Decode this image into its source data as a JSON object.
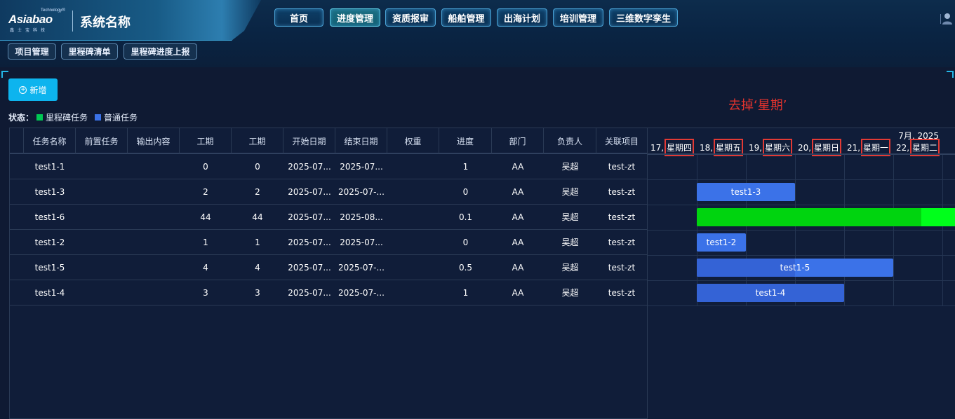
{
  "header": {
    "logo_trademark": "Technology®",
    "logo_text": "Asiabao",
    "logo_tagline": "鑫士宝科技",
    "app_title": "系统名称",
    "nav": [
      {
        "label": "首页",
        "active": false
      },
      {
        "label": "进度管理",
        "active": true
      },
      {
        "label": "资质报审",
        "active": false
      },
      {
        "label": "船舶管理",
        "active": false
      },
      {
        "label": "出海计划",
        "active": false
      },
      {
        "label": "培训管理",
        "active": false
      },
      {
        "label": "三维数字孪生",
        "active": false
      }
    ],
    "sub_nav": [
      "项目管理",
      "里程碑清单",
      "里程碑进度上报"
    ]
  },
  "toolbar": {
    "add_label": "新增",
    "add_icon": "plus-circle-icon"
  },
  "legend": {
    "label": "状态：",
    "items": [
      {
        "name": "里程碑任务",
        "color": "#00c853"
      },
      {
        "name": "普通任务",
        "color": "#3b72e8"
      }
    ]
  },
  "annotation": "去掉‘星期’",
  "table": {
    "columns": [
      "任务名称",
      "前置任务",
      "输出内容",
      "工期",
      "工期",
      "开始日期",
      "结束日期",
      "权重",
      "进度",
      "部门",
      "负责人",
      "关联项目"
    ],
    "rows": [
      {
        "name": "test1-1",
        "pre": "",
        "output": "",
        "dur1": "0",
        "dur2": "0",
        "start": "2025-07...",
        "end": "2025-07...",
        "weight": "",
        "progress": "1",
        "dept": "AA",
        "owner": "吴超",
        "project": "test-zt"
      },
      {
        "name": "test1-3",
        "pre": "",
        "output": "",
        "dur1": "2",
        "dur2": "2",
        "start": "2025-07...",
        "end": "2025-07-...",
        "weight": "",
        "progress": "0",
        "dept": "AA",
        "owner": "吴超",
        "project": "test-zt"
      },
      {
        "name": "test1-6",
        "pre": "",
        "output": "",
        "dur1": "44",
        "dur2": "44",
        "start": "2025-07...",
        "end": "2025-08...",
        "weight": "",
        "progress": "0.1",
        "dept": "AA",
        "owner": "吴超",
        "project": "test-zt"
      },
      {
        "name": "test1-2",
        "pre": "",
        "output": "",
        "dur1": "1",
        "dur2": "1",
        "start": "2025-07...",
        "end": "2025-07...",
        "weight": "",
        "progress": "0",
        "dept": "AA",
        "owner": "吴超",
        "project": "test-zt"
      },
      {
        "name": "test1-5",
        "pre": "",
        "output": "",
        "dur1": "4",
        "dur2": "4",
        "start": "2025-07...",
        "end": "2025-07-...",
        "weight": "",
        "progress": "0.5",
        "dept": "AA",
        "owner": "吴超",
        "project": "test-zt"
      },
      {
        "name": "test1-4",
        "pre": "",
        "output": "",
        "dur1": "3",
        "dur2": "3",
        "start": "2025-07...",
        "end": "2025-07-...",
        "weight": "",
        "progress": "1",
        "dept": "AA",
        "owner": "吴超",
        "project": "test-zt"
      }
    ]
  },
  "gantt": {
    "month_label": "7月, 2025",
    "days": [
      {
        "num": "17,",
        "weekday": "星期四"
      },
      {
        "num": "18,",
        "weekday": "星期五"
      },
      {
        "num": "19,",
        "weekday": "星期六"
      },
      {
        "num": "20,",
        "weekday": "星期日"
      },
      {
        "num": "21,",
        "weekday": "星期一"
      },
      {
        "num": "22,",
        "weekday": "星期二"
      }
    ],
    "bars": [
      {
        "row": 1,
        "label": "test1-3",
        "start_day": 1,
        "span_days": 2,
        "type": "normal",
        "progress": 0
      },
      {
        "row": 2,
        "label": "",
        "start_day": 1,
        "span_days": 44,
        "type": "milestone",
        "progress": 0.1
      },
      {
        "row": 3,
        "label": "test1-2",
        "start_day": 1,
        "span_days": 1,
        "type": "normal",
        "progress": 0
      },
      {
        "row": 4,
        "label": "test1-5",
        "start_day": 1,
        "span_days": 4,
        "type": "normal",
        "progress": 0.5
      },
      {
        "row": 5,
        "label": "test1-4",
        "start_day": 1,
        "span_days": 3,
        "type": "normal",
        "progress": 1
      }
    ]
  }
}
